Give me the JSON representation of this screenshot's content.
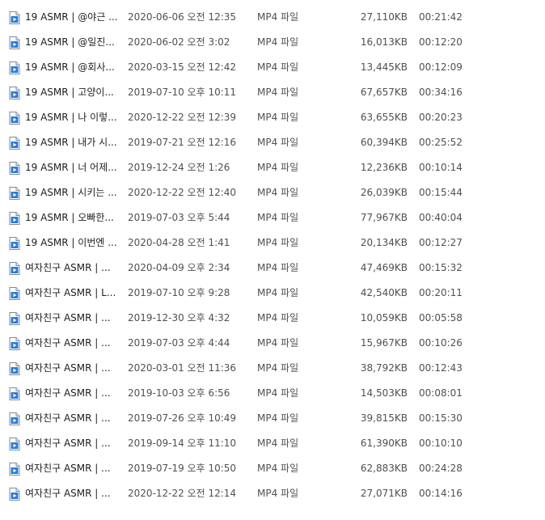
{
  "icon": "mp4-video-file-icon",
  "files": [
    {
      "name": "19 ASMR | @야근 ...",
      "date": "2020-06-06 오전 12:35",
      "type": "MP4 파일",
      "size": "27,110KB",
      "length": "00:21:42"
    },
    {
      "name": "19 ASMR | @일진...",
      "date": "2020-06-02 오전 3:02",
      "type": "MP4 파일",
      "size": "16,013KB",
      "length": "00:12:20"
    },
    {
      "name": "19 ASMR | @회사...",
      "date": "2020-03-15 오전 12:42",
      "type": "MP4 파일",
      "size": "13,445KB",
      "length": "00:12:09"
    },
    {
      "name": "19 ASMR | 고양이...",
      "date": "2019-07-10 오후 10:11",
      "type": "MP4 파일",
      "size": "67,657KB",
      "length": "00:34:16"
    },
    {
      "name": "19 ASMR | 나 이렇...",
      "date": "2020-12-22 오전 12:39",
      "type": "MP4 파일",
      "size": "63,655KB",
      "length": "00:20:23"
    },
    {
      "name": "19 ASMR | 내가 시...",
      "date": "2019-07-21 오전 12:16",
      "type": "MP4 파일",
      "size": "60,394KB",
      "length": "00:25:52"
    },
    {
      "name": "19 ASMR | 너 어제...",
      "date": "2019-12-24 오전 1:26",
      "type": "MP4 파일",
      "size": "12,236KB",
      "length": "00:10:14"
    },
    {
      "name": "19 ASMR | 시키는 ...",
      "date": "2020-12-22 오전 12:40",
      "type": "MP4 파일",
      "size": "26,039KB",
      "length": "00:15:44"
    },
    {
      "name": "19 ASMR | 오빠한...",
      "date": "2019-07-03 오후 5:44",
      "type": "MP4 파일",
      "size": "77,967KB",
      "length": "00:40:04"
    },
    {
      "name": "19 ASMR | 이번엔 ...",
      "date": "2020-04-28 오전 1:41",
      "type": "MP4 파일",
      "size": "20,134KB",
      "length": "00:12:27"
    },
    {
      "name": "여자친구 ASMR | ...",
      "date": "2020-04-09 오후 2:34",
      "type": "MP4 파일",
      "size": "47,469KB",
      "length": "00:15:32"
    },
    {
      "name": "여자친구 ASMR | L...",
      "date": "2019-07-10 오후 9:28",
      "type": "MP4 파일",
      "size": "42,540KB",
      "length": "00:20:11"
    },
    {
      "name": "여자친구 ASMR | ...",
      "date": "2019-12-30 오후 4:32",
      "type": "MP4 파일",
      "size": "10,059KB",
      "length": "00:05:58"
    },
    {
      "name": "여자친구 ASMR | ...",
      "date": "2019-07-03 오후 4:44",
      "type": "MP4 파일",
      "size": "15,967KB",
      "length": "00:10:26"
    },
    {
      "name": "여자친구 ASMR | ...",
      "date": "2020-03-01 오전 11:36",
      "type": "MP4 파일",
      "size": "38,792KB",
      "length": "00:12:43"
    },
    {
      "name": "여자친구 ASMR | ...",
      "date": "2019-10-03 오후 6:56",
      "type": "MP4 파일",
      "size": "14,503KB",
      "length": "00:08:01"
    },
    {
      "name": "여자친구 ASMR | ...",
      "date": "2019-07-26 오후 10:49",
      "type": "MP4 파일",
      "size": "39,815KB",
      "length": "00:15:30"
    },
    {
      "name": "여자친구 ASMR | ...",
      "date": "2019-09-14 오후 11:10",
      "type": "MP4 파일",
      "size": "61,390KB",
      "length": "00:10:10"
    },
    {
      "name": "여자친구 ASMR | ...",
      "date": "2019-07-19 오후 10:50",
      "type": "MP4 파일",
      "size": "62,883KB",
      "length": "00:24:28"
    },
    {
      "name": "여자친구 ASMR | ...",
      "date": "2020-12-22 오전 12:14",
      "type": "MP4 파일",
      "size": "27,071KB",
      "length": "00:14:16"
    }
  ]
}
